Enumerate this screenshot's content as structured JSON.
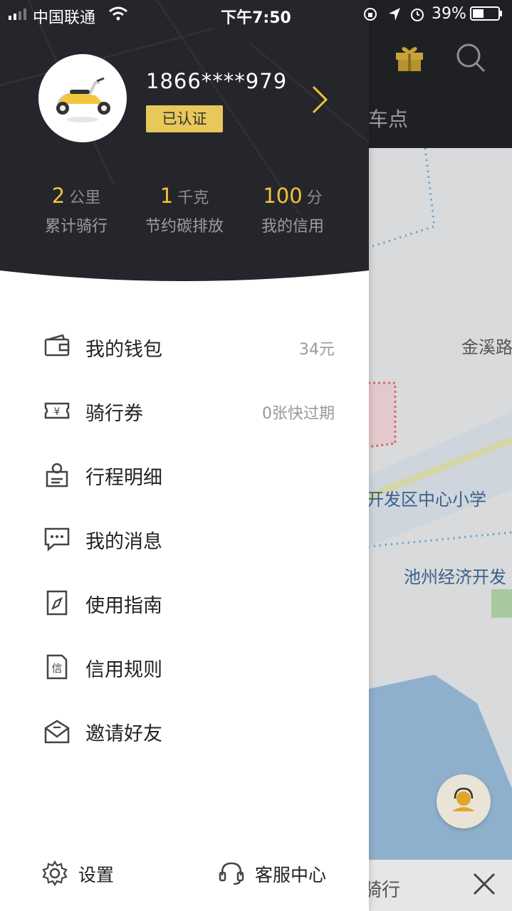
{
  "status_bar": {
    "carrier": "中国联通",
    "time": "下午7:50",
    "battery": "39%"
  },
  "background": {
    "tab_label": "车点",
    "ride_label": "骑行",
    "map_labels": {
      "street": "金溪路",
      "school": "开发区中心小学",
      "dev_zone": "池州经济开发"
    }
  },
  "profile": {
    "phone": "1866****979",
    "badge": "已认证"
  },
  "stats": [
    {
      "value": "2",
      "unit": "公里",
      "label": "累计骑行"
    },
    {
      "value": "1",
      "unit": "千克",
      "label": "节约碳排放"
    },
    {
      "value": "100",
      "unit": "分",
      "label": "我的信用"
    }
  ],
  "menu": [
    {
      "label": "我的钱包",
      "value": "34元",
      "icon": "wallet-icon"
    },
    {
      "label": "骑行券",
      "value": "0张快过期",
      "icon": "coupon-icon"
    },
    {
      "label": "行程明细",
      "value": "",
      "icon": "trip-detail-icon"
    },
    {
      "label": "我的消息",
      "value": "",
      "icon": "message-icon"
    },
    {
      "label": "使用指南",
      "value": "",
      "icon": "guide-icon"
    },
    {
      "label": "信用规则",
      "value": "",
      "icon": "credit-rules-icon"
    },
    {
      "label": "邀请好友",
      "value": "",
      "icon": "invite-icon"
    }
  ],
  "footer": {
    "settings": "设置",
    "service": "客服中心"
  },
  "colors": {
    "accent": "#f0c33a",
    "header_bg": "#25262b",
    "badge_bg": "#e8c75b"
  }
}
